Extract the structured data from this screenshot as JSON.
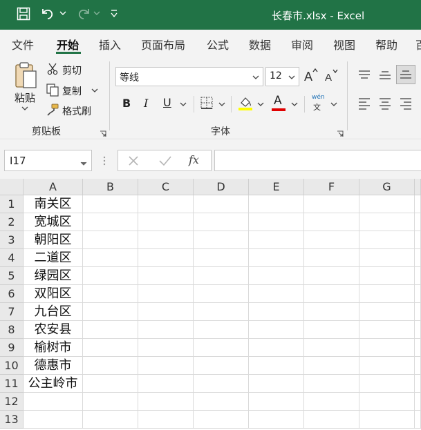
{
  "titlebar": {
    "title": "长春市.xlsx  -  Excel",
    "icons": [
      "save-icon",
      "undo-icon",
      "redo-icon",
      "customize-icon"
    ],
    "colors": {
      "background": "#217346",
      "text": "#ffffff"
    }
  },
  "tabs": [
    {
      "label": "文件",
      "active": false
    },
    {
      "label": "开始",
      "active": true
    },
    {
      "label": "插入",
      "active": false
    },
    {
      "label": "页面布局",
      "active": false
    },
    {
      "label": "公式",
      "active": false
    },
    {
      "label": "数据",
      "active": false
    },
    {
      "label": "审阅",
      "active": false
    },
    {
      "label": "视图",
      "active": false
    },
    {
      "label": "帮助",
      "active": false
    },
    {
      "label": "百",
      "active": false
    }
  ],
  "ribbon": {
    "clipboard": {
      "paste_label": "粘贴",
      "cut_label": "剪切",
      "copy_label": "复制",
      "format_painter_label": "格式刷",
      "group_label": "剪贴板"
    },
    "font": {
      "font_name": "等线",
      "font_size": "12",
      "bold": "B",
      "italic": "I",
      "underline": "U",
      "font_color_glyph": "A",
      "phonetic_top": "wén",
      "phonetic_bottom": "文",
      "group_label": "字体",
      "fill_color": "#ffff00",
      "font_color": "#e00000"
    }
  },
  "formula_bar": {
    "name_box": "I17",
    "fx_label": "fx",
    "formula": ""
  },
  "sheet": {
    "columns": [
      "A",
      "B",
      "C",
      "D",
      "E",
      "F",
      "G"
    ],
    "rows": [
      {
        "num": "1",
        "a": "南关区"
      },
      {
        "num": "2",
        "a": "宽城区"
      },
      {
        "num": "3",
        "a": "朝阳区"
      },
      {
        "num": "4",
        "a": "二道区"
      },
      {
        "num": "5",
        "a": "绿园区"
      },
      {
        "num": "6",
        "a": "双阳区"
      },
      {
        "num": "7",
        "a": "九台区"
      },
      {
        "num": "8",
        "a": "农安县"
      },
      {
        "num": "9",
        "a": "榆树市"
      },
      {
        "num": "10",
        "a": "德惠市"
      },
      {
        "num": "11",
        "a": "公主岭市"
      },
      {
        "num": "12",
        "a": ""
      },
      {
        "num": "13",
        "a": ""
      }
    ]
  }
}
